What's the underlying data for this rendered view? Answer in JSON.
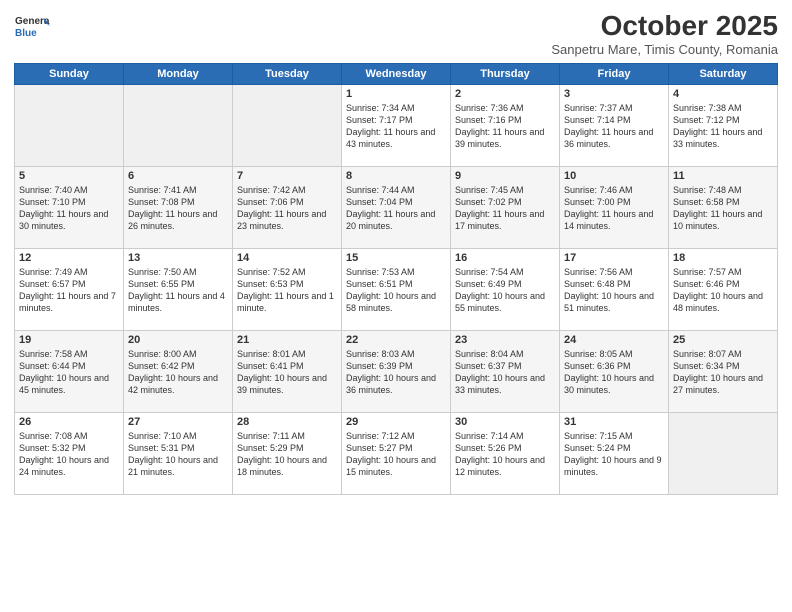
{
  "header": {
    "logo_general": "General",
    "logo_blue": "Blue",
    "month_title": "October 2025",
    "subtitle": "Sanpetru Mare, Timis County, Romania"
  },
  "weekdays": [
    "Sunday",
    "Monday",
    "Tuesday",
    "Wednesday",
    "Thursday",
    "Friday",
    "Saturday"
  ],
  "weeks": [
    [
      {
        "day": "",
        "info": ""
      },
      {
        "day": "",
        "info": ""
      },
      {
        "day": "",
        "info": ""
      },
      {
        "day": "1",
        "info": "Sunrise: 7:34 AM\nSunset: 7:17 PM\nDaylight: 11 hours and 43 minutes."
      },
      {
        "day": "2",
        "info": "Sunrise: 7:36 AM\nSunset: 7:16 PM\nDaylight: 11 hours and 39 minutes."
      },
      {
        "day": "3",
        "info": "Sunrise: 7:37 AM\nSunset: 7:14 PM\nDaylight: 11 hours and 36 minutes."
      },
      {
        "day": "4",
        "info": "Sunrise: 7:38 AM\nSunset: 7:12 PM\nDaylight: 11 hours and 33 minutes."
      }
    ],
    [
      {
        "day": "5",
        "info": "Sunrise: 7:40 AM\nSunset: 7:10 PM\nDaylight: 11 hours and 30 minutes."
      },
      {
        "day": "6",
        "info": "Sunrise: 7:41 AM\nSunset: 7:08 PM\nDaylight: 11 hours and 26 minutes."
      },
      {
        "day": "7",
        "info": "Sunrise: 7:42 AM\nSunset: 7:06 PM\nDaylight: 11 hours and 23 minutes."
      },
      {
        "day": "8",
        "info": "Sunrise: 7:44 AM\nSunset: 7:04 PM\nDaylight: 11 hours and 20 minutes."
      },
      {
        "day": "9",
        "info": "Sunrise: 7:45 AM\nSunset: 7:02 PM\nDaylight: 11 hours and 17 minutes."
      },
      {
        "day": "10",
        "info": "Sunrise: 7:46 AM\nSunset: 7:00 PM\nDaylight: 11 hours and 14 minutes."
      },
      {
        "day": "11",
        "info": "Sunrise: 7:48 AM\nSunset: 6:58 PM\nDaylight: 11 hours and 10 minutes."
      }
    ],
    [
      {
        "day": "12",
        "info": "Sunrise: 7:49 AM\nSunset: 6:57 PM\nDaylight: 11 hours and 7 minutes."
      },
      {
        "day": "13",
        "info": "Sunrise: 7:50 AM\nSunset: 6:55 PM\nDaylight: 11 hours and 4 minutes."
      },
      {
        "day": "14",
        "info": "Sunrise: 7:52 AM\nSunset: 6:53 PM\nDaylight: 11 hours and 1 minute."
      },
      {
        "day": "15",
        "info": "Sunrise: 7:53 AM\nSunset: 6:51 PM\nDaylight: 10 hours and 58 minutes."
      },
      {
        "day": "16",
        "info": "Sunrise: 7:54 AM\nSunset: 6:49 PM\nDaylight: 10 hours and 55 minutes."
      },
      {
        "day": "17",
        "info": "Sunrise: 7:56 AM\nSunset: 6:48 PM\nDaylight: 10 hours and 51 minutes."
      },
      {
        "day": "18",
        "info": "Sunrise: 7:57 AM\nSunset: 6:46 PM\nDaylight: 10 hours and 48 minutes."
      }
    ],
    [
      {
        "day": "19",
        "info": "Sunrise: 7:58 AM\nSunset: 6:44 PM\nDaylight: 10 hours and 45 minutes."
      },
      {
        "day": "20",
        "info": "Sunrise: 8:00 AM\nSunset: 6:42 PM\nDaylight: 10 hours and 42 minutes."
      },
      {
        "day": "21",
        "info": "Sunrise: 8:01 AM\nSunset: 6:41 PM\nDaylight: 10 hours and 39 minutes."
      },
      {
        "day": "22",
        "info": "Sunrise: 8:03 AM\nSunset: 6:39 PM\nDaylight: 10 hours and 36 minutes."
      },
      {
        "day": "23",
        "info": "Sunrise: 8:04 AM\nSunset: 6:37 PM\nDaylight: 10 hours and 33 minutes."
      },
      {
        "day": "24",
        "info": "Sunrise: 8:05 AM\nSunset: 6:36 PM\nDaylight: 10 hours and 30 minutes."
      },
      {
        "day": "25",
        "info": "Sunrise: 8:07 AM\nSunset: 6:34 PM\nDaylight: 10 hours and 27 minutes."
      }
    ],
    [
      {
        "day": "26",
        "info": "Sunrise: 7:08 AM\nSunset: 5:32 PM\nDaylight: 10 hours and 24 minutes."
      },
      {
        "day": "27",
        "info": "Sunrise: 7:10 AM\nSunset: 5:31 PM\nDaylight: 10 hours and 21 minutes."
      },
      {
        "day": "28",
        "info": "Sunrise: 7:11 AM\nSunset: 5:29 PM\nDaylight: 10 hours and 18 minutes."
      },
      {
        "day": "29",
        "info": "Sunrise: 7:12 AM\nSunset: 5:27 PM\nDaylight: 10 hours and 15 minutes."
      },
      {
        "day": "30",
        "info": "Sunrise: 7:14 AM\nSunset: 5:26 PM\nDaylight: 10 hours and 12 minutes."
      },
      {
        "day": "31",
        "info": "Sunrise: 7:15 AM\nSunset: 5:24 PM\nDaylight: 10 hours and 9 minutes."
      },
      {
        "day": "",
        "info": ""
      }
    ]
  ]
}
